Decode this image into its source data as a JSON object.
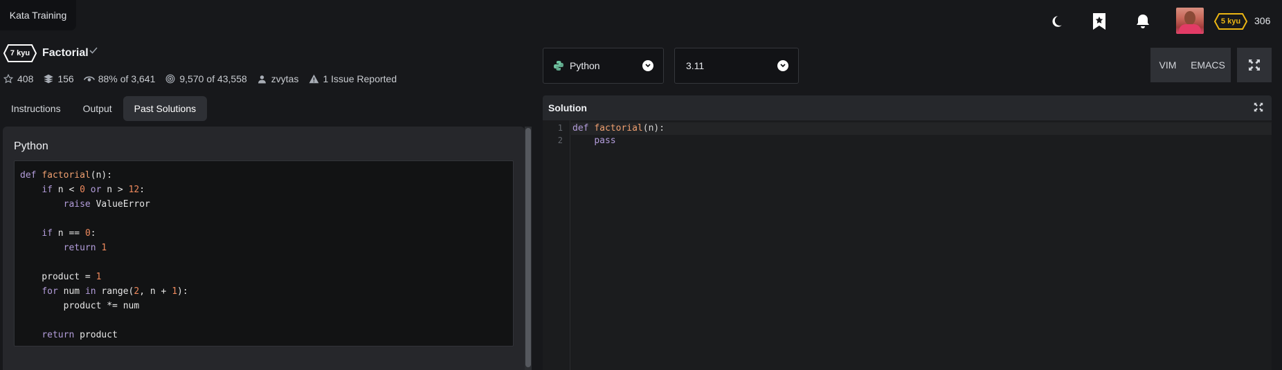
{
  "topbar": {
    "brand": "Kata Training",
    "icons": [
      "moon-icon",
      "bookmark-star-icon",
      "bell-icon"
    ],
    "rank": "5 kyu",
    "honor": "306",
    "rank_color": "#ecb613"
  },
  "kata": {
    "rank": "7 kyu",
    "title": "Factorial",
    "stats": {
      "stars": "408",
      "collections": "156",
      "satisfaction": "88%",
      "satisfaction_of": "of 3,641",
      "completed": "9,570",
      "completed_of": "of 43,558",
      "author": "zvytas",
      "issues": "1 Issue Reported"
    }
  },
  "tabs": [
    {
      "label": "Instructions",
      "active": false
    },
    {
      "label": "Output",
      "active": false
    },
    {
      "label": "Past Solutions",
      "active": true
    }
  ],
  "past_solution": {
    "language": "Python",
    "code_lines": [
      "def factorial(n):",
      "    if n < 0 or n > 12:",
      "        raise ValueError",
      "",
      "    if n == 0:",
      "        return 1",
      "",
      "    product = 1",
      "    for num in range(2, n + 1):",
      "        product *= num",
      "",
      "    return product"
    ]
  },
  "editor": {
    "language": "Python",
    "version": "3.11",
    "modes": [
      "VIM",
      "EMACS"
    ],
    "panel_title": "Solution",
    "lines": [
      "1",
      "2"
    ],
    "code_lines": [
      "def factorial(n):",
      "    pass"
    ]
  }
}
